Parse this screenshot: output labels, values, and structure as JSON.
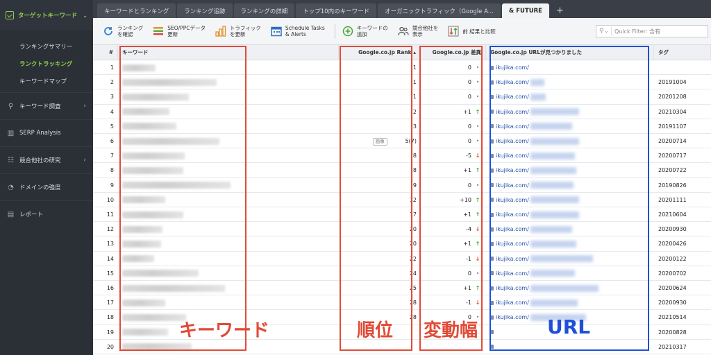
{
  "sidebar": {
    "header": "ターゲットキーワード",
    "subitems": [
      "ランキングサマリー",
      "ランクトラッキング",
      "キーワードマップ"
    ],
    "items": [
      "キーワード調査",
      "SERP Analysis",
      "競合他社の研究",
      "ドメインの強度",
      "レポート"
    ]
  },
  "tabs": [
    "キーワードとランキング",
    "ランキング追跡",
    "ランキングの詳細",
    "トップ10内のキーワード",
    "オーガニックトラフィック（Google A...",
    "& FUTURE"
  ],
  "toolbar": {
    "b1_l1": "ランキング",
    "b1_l2": "を確認",
    "b2_l1": "SEO/PPCデータ",
    "b2_l2": "更新",
    "b3_l1": "トラフィック",
    "b3_l2": "を更新",
    "b4_l1": "Schedule Tasks",
    "b4_l2": "& Alerts",
    "b5_l1": "キーワードの",
    "b5_l2": "追加",
    "b6_l1": "競合他社を",
    "b6_l2": "表示",
    "b7": "前 結果と比較",
    "filter_label": "Quick Filter: 含有"
  },
  "table": {
    "headers": [
      "#",
      "キーワード",
      "Google.co.jp Rank",
      "Google.co.jp 差異",
      "Google.co.jp URLが見つかりました",
      "タグ"
    ],
    "image_badge": "画像",
    "rows": [
      {
        "n": "1",
        "rank": "1",
        "diff": "0",
        "trend": "none",
        "url": "ikujika.com/",
        "tag": ""
      },
      {
        "n": "2",
        "rank": "1",
        "diff": "0",
        "trend": "none",
        "url": "ikujika.com/",
        "tag": "20191004"
      },
      {
        "n": "3",
        "rank": "1",
        "diff": "0",
        "trend": "none",
        "url": "ikujika.com/",
        "tag": "20201208"
      },
      {
        "n": "4",
        "rank": "2",
        "diff": "+1",
        "trend": "up",
        "url": "ikujika.com/",
        "tag": "20210304"
      },
      {
        "n": "5",
        "rank": "3",
        "diff": "0",
        "trend": "none",
        "url": "ikujika.com/",
        "tag": "20191107"
      },
      {
        "n": "6",
        "rank": "5(7)",
        "diff": "0",
        "trend": "none",
        "url": "ikujika.com/",
        "tag": "20200714",
        "img": true
      },
      {
        "n": "7",
        "rank": "8",
        "diff": "-5",
        "trend": "down",
        "url": "ikujika.com/",
        "tag": "20200717"
      },
      {
        "n": "8",
        "rank": "8",
        "diff": "+1",
        "trend": "up",
        "url": "ikujika.com/",
        "tag": "20200722"
      },
      {
        "n": "9",
        "rank": "9",
        "diff": "0",
        "trend": "none",
        "url": "ikujika.com/",
        "tag": "20190826"
      },
      {
        "n": "10",
        "rank": "12",
        "diff": "+10",
        "trend": "up",
        "url": "ikujika.com/",
        "tag": "20201111"
      },
      {
        "n": "11",
        "rank": "17",
        "diff": "+1",
        "trend": "up",
        "url": "ikujika.com/",
        "tag": "20210604"
      },
      {
        "n": "12",
        "rank": "20",
        "diff": "-4",
        "trend": "down",
        "url": "ikujika.com/",
        "tag": "20200930"
      },
      {
        "n": "13",
        "rank": "20",
        "diff": "+1",
        "trend": "up",
        "url": "ikujika.com/",
        "tag": "20200426"
      },
      {
        "n": "14",
        "rank": "22",
        "diff": "-1",
        "trend": "down",
        "url": "ikujika.com/",
        "tag": "20200122"
      },
      {
        "n": "15",
        "rank": "24",
        "diff": "0",
        "trend": "none",
        "url": "ikujika.com/",
        "tag": "20200702"
      },
      {
        "n": "16",
        "rank": "25",
        "diff": "+1",
        "trend": "up",
        "url": "ikujika.com/",
        "tag": "20200624"
      },
      {
        "n": "17",
        "rank": "28",
        "diff": "-1",
        "trend": "down",
        "url": "ikujika.com/",
        "tag": "20200930"
      },
      {
        "n": "18",
        "rank": "28",
        "diff": "0",
        "trend": "none",
        "url": "ikujika.com/",
        "tag": "20210514"
      },
      {
        "n": "19",
        "rank": "",
        "diff": "",
        "trend": "none",
        "url": "",
        "tag": "20200828"
      },
      {
        "n": "20",
        "rank": "",
        "diff": "",
        "trend": "none",
        "url": "",
        "tag": "20210317"
      }
    ]
  },
  "annotations": {
    "keyword": "キーワード",
    "rank": "順位",
    "change": "変動幅",
    "url": "URL"
  },
  "colors": {
    "accent": "#8fd14f",
    "annotation_red": "#e04a36",
    "annotation_blue": "#1f4fd8"
  }
}
